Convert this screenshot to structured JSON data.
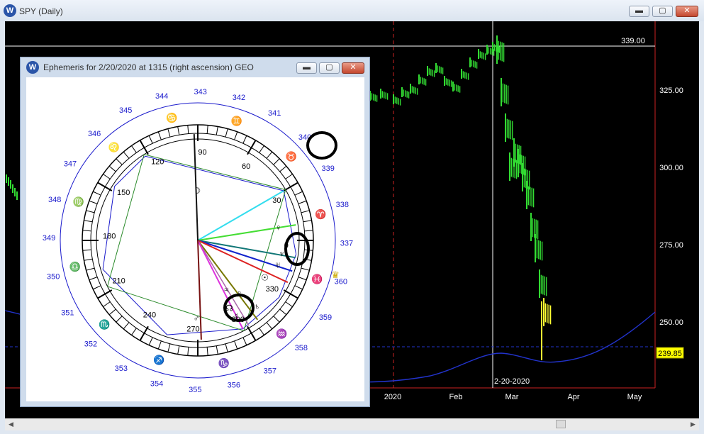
{
  "main_window": {
    "title": "SPY (Daily)",
    "icon_letter": "W"
  },
  "chart": {
    "price_labels": [
      "325.00",
      "300.00",
      "275.00",
      "250.00"
    ],
    "high_label": "339.00",
    "current_price": "239.85",
    "month_labels": [
      "2020",
      "Feb",
      "Mar",
      "Apr",
      "May"
    ],
    "date_marker": "2-20-2020",
    "colors": {
      "bars": "#33dd33",
      "current_bar": "#ffff33",
      "red_line": "#cc2222",
      "blue_curve": "#2233cc",
      "price_tag": "#ffff00"
    }
  },
  "ephemeris": {
    "title": "Ephemeris for 2/20/2020 at 1315 (right ascension) GEO",
    "icon_letter": "W",
    "inner_degrees": [
      "0",
      "30",
      "60",
      "90",
      "120",
      "150",
      "180",
      "210",
      "240",
      "270",
      "300",
      "330"
    ],
    "outer_numbers": [
      "337",
      "338",
      "339",
      "340",
      "341",
      "342",
      "343",
      "344",
      "345",
      "346",
      "347",
      "348",
      "349",
      "350",
      "351",
      "352",
      "353",
      "354",
      "355",
      "356",
      "357",
      "358",
      "359",
      "360"
    ],
    "zodiac_glyphs": [
      "♓",
      "♈",
      "♉",
      "♊",
      "♋",
      "♌",
      "♍",
      "♎",
      "♏",
      "♐",
      "♑",
      "♒"
    ],
    "planet_glyphs": [
      "♆",
      "♀",
      "☉",
      "♅",
      "♃",
      "♇",
      "☊",
      "♂",
      "☿",
      "♄",
      "☽"
    ],
    "crown_glyph": "♛",
    "colors": {
      "outer_ring": "#1a1acc",
      "number_blue": "#1a1acc",
      "zodiac": "#2a8a2a"
    }
  }
}
